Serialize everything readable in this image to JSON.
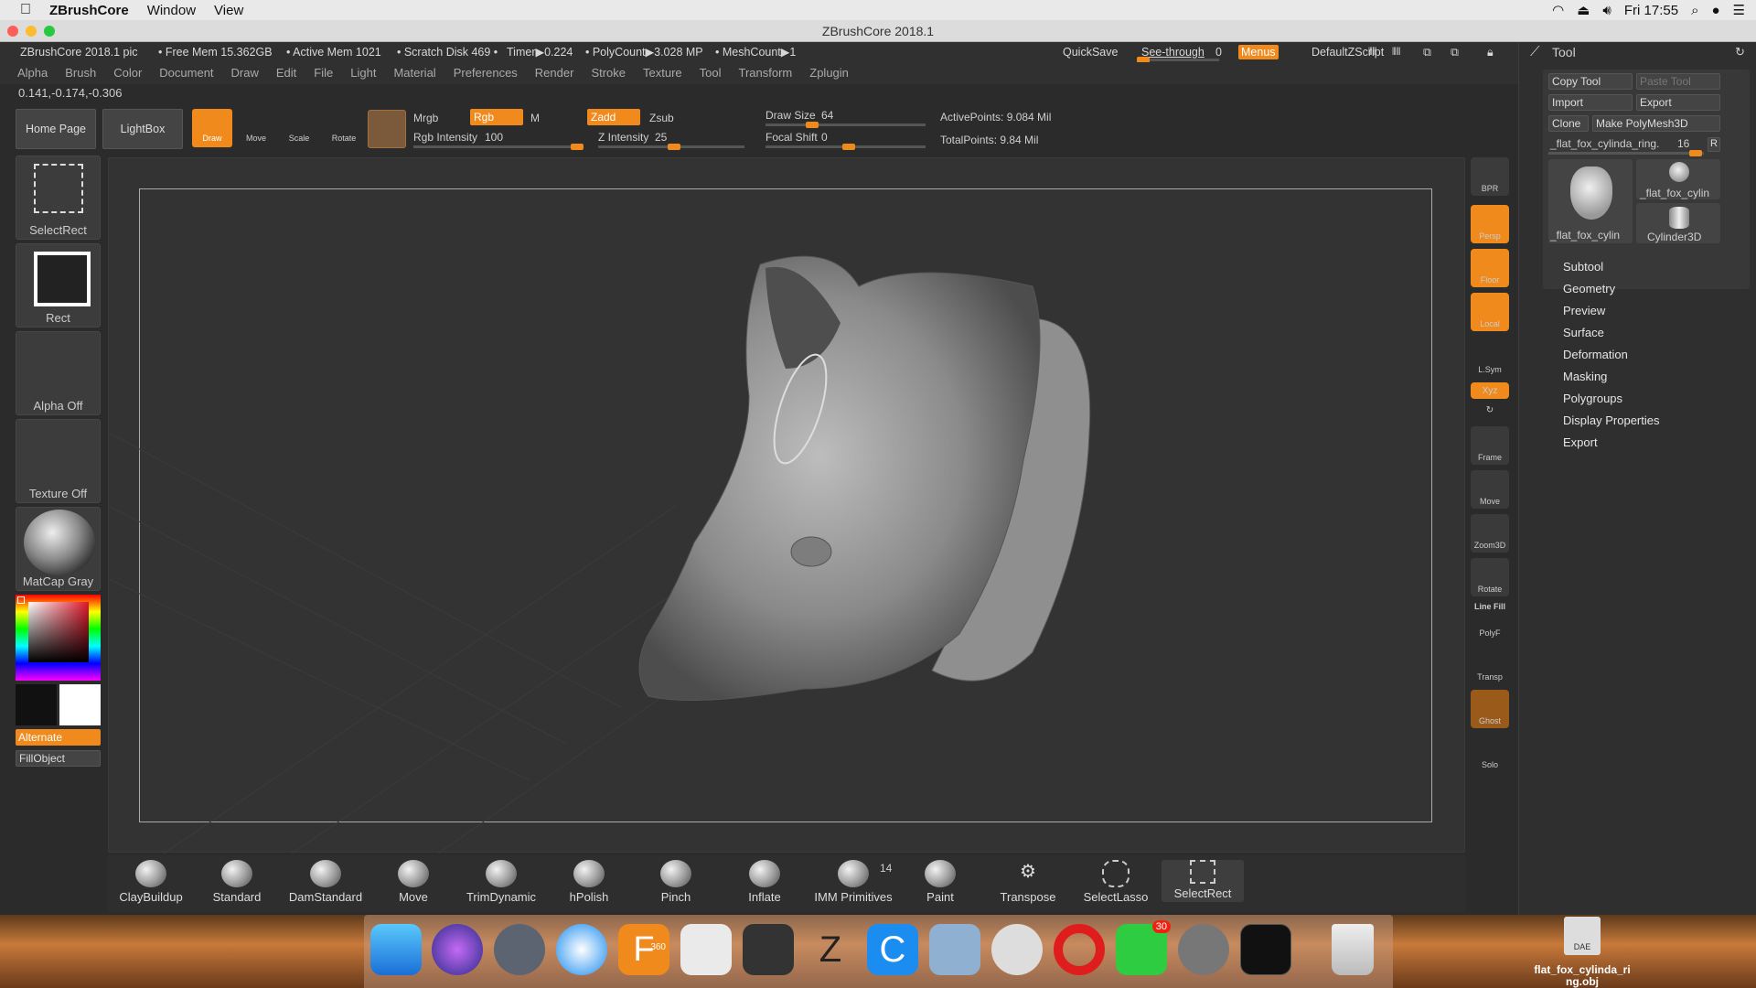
{
  "mac_menu": {
    "apple": "",
    "app": "ZBrushCore",
    "items": [
      "Window",
      "View"
    ],
    "clock": "Fri 17:55"
  },
  "window_title": "ZBrushCore 2018.1",
  "info": {
    "left": "ZBrushCore 2018.1 pic",
    "free_mem": "• Free Mem 15.362GB",
    "active_mem": "• Active Mem 1021",
    "scratch": "• Scratch Disk 469 •",
    "timer": "Timer▶0.224",
    "polycount": "• PolyCount▶3.028 MP",
    "meshcount": "• MeshCount▶1",
    "quicksave": "QuickSave",
    "seethrough": "See-through",
    "seethrough_val": "0",
    "menus": "Menus",
    "default_script": "DefaultZScript"
  },
  "menus": [
    "Alpha",
    "Brush",
    "Color",
    "Document",
    "Draw",
    "Edit",
    "File",
    "Light",
    "Material",
    "Preferences",
    "Render",
    "Stroke",
    "Texture",
    "Tool",
    "Transform",
    "Zplugin"
  ],
  "coords": "0.141,-0.174,-0.306",
  "top": {
    "home": "Home Page",
    "lightbox": "LightBox",
    "draw": "Draw",
    "move": "Move",
    "scale": "Scale",
    "rotate": "Rotate",
    "mrgb": "Mrgb",
    "rgb": "Rgb",
    "m": "M",
    "zadd": "Zadd",
    "zsub": "Zsub",
    "rgb_int_label": "Rgb Intensity",
    "rgb_int_val": "100",
    "z_int_label": "Z Intensity",
    "z_int_val": "25",
    "draw_size_label": "Draw Size",
    "draw_size_val": "64",
    "focal_label": "Focal Shift",
    "focal_val": "0",
    "active_points": "ActivePoints: 9.084 Mil",
    "total_points": "TotalPoints: 9.84 Mil"
  },
  "left": {
    "selectrect": "SelectRect",
    "rect": "Rect",
    "alpha": "Alpha Off",
    "texture": "Texture Off",
    "matcap": "MatCap Gray",
    "alternate": "Alternate",
    "fillobject": "FillObject"
  },
  "right_toolbar": [
    "BPR",
    "Persp",
    "Floor",
    "Local",
    "L.Sym",
    "Xyz",
    "",
    "Frame",
    "Move",
    "Zoom3D",
    "Rotate",
    "PolyF",
    "Transp",
    "Ghost",
    "Solo"
  ],
  "right_toolbar_extra": {
    "linefill": "Line Fill"
  },
  "tool_panel": {
    "title": "Tool",
    "copy_tool": "Copy Tool",
    "paste_tool": "Paste Tool",
    "import": "Import",
    "export": "Export",
    "clone": "Clone",
    "make_polymesh": "Make PolyMesh3D",
    "current_tool": "_flat_fox_cylinda_ring.",
    "current_num": "16",
    "r": "R",
    "thumb1": "_flat_fox_cylin",
    "thumb2": "_flat_fox_cylin",
    "thumb3": "Cylinder3D",
    "sections": [
      "Subtool",
      "Geometry",
      "Preview",
      "Surface",
      "Deformation",
      "Masking",
      "Polygroups",
      "Display Properties",
      "Export"
    ]
  },
  "brushes": [
    {
      "label": "ClayBuildup"
    },
    {
      "label": "Standard"
    },
    {
      "label": "DamStandard"
    },
    {
      "label": "Move"
    },
    {
      "label": "TrimDynamic"
    },
    {
      "label": "hPolish"
    },
    {
      "label": "Pinch"
    },
    {
      "label": "Inflate"
    },
    {
      "label": "IMM Primitives"
    },
    {
      "label": "Paint"
    },
    {
      "label": "Transpose"
    },
    {
      "label": "SelectLasso"
    },
    {
      "label": "SelectRect"
    }
  ],
  "imm_count": "14",
  "dock": {
    "badge": "30",
    "file_label1": "flat_fox_cylinda_ri",
    "file_label2": "ng.obj",
    "file_type": "DAE",
    "fusion_badge": "360"
  },
  "colors": {
    "accent": "#f08a1c",
    "panel": "#303030",
    "viewport": "#333333"
  }
}
